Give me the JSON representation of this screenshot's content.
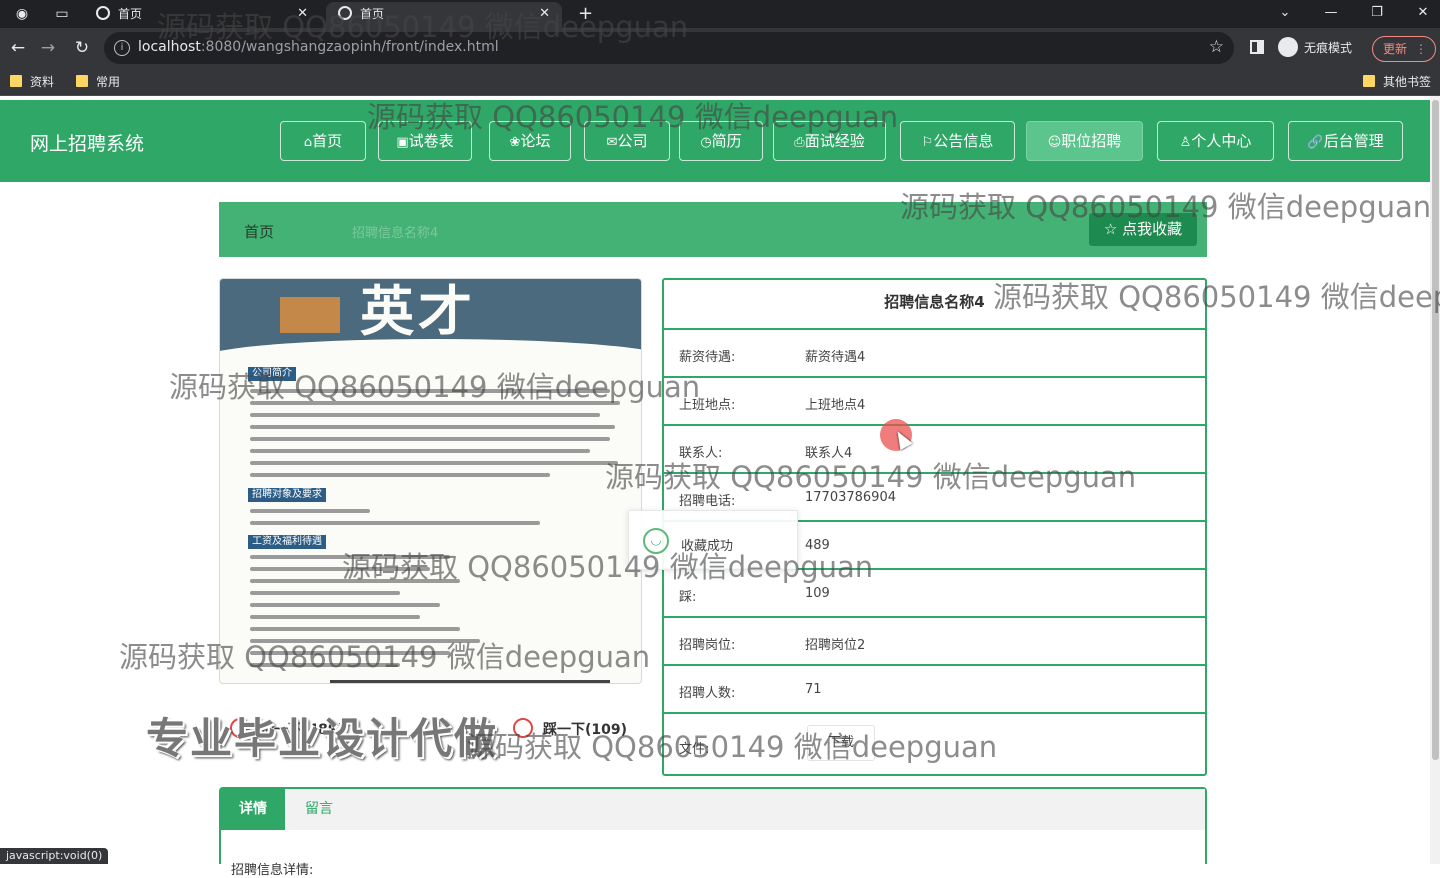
{
  "browser": {
    "tabs": [
      {
        "title": "首页"
      },
      {
        "title": "首页"
      }
    ],
    "url_host": "localhost",
    "url_rest": ":8080/wangshangzaopinh/front/index.html",
    "incognito_label": "无痕模式",
    "update_label": "更新",
    "bookmarks": [
      "资料",
      "常用"
    ],
    "other_bookmarks": "其他书签",
    "status_url": "javascript:void(0)"
  },
  "site": {
    "title": "网上招聘系统",
    "nav": [
      {
        "label": "首页",
        "icon": "home-icon",
        "glyph": "⌂"
      },
      {
        "label": "试卷表",
        "icon": "paper-icon",
        "glyph": "▣"
      },
      {
        "label": "论坛",
        "icon": "chat-icon",
        "glyph": "❀"
      },
      {
        "label": "公司",
        "icon": "mail-icon",
        "glyph": "✉"
      },
      {
        "label": "简历",
        "icon": "power-icon",
        "glyph": "◷"
      },
      {
        "label": "面试经验",
        "icon": "print-icon",
        "glyph": "⎙"
      },
      {
        "label": "公告信息",
        "icon": "flag-icon",
        "glyph": "⚐"
      },
      {
        "label": "职位招聘",
        "icon": "emoji-icon",
        "glyph": "☺"
      },
      {
        "label": "个人中心",
        "icon": "user-icon",
        "glyph": "♙"
      },
      {
        "label": "后台管理",
        "icon": "link-icon",
        "glyph": "🔗"
      }
    ],
    "active_nav": "职位招聘",
    "accent": "#2fa867"
  },
  "breadcrumb": {
    "home": "首页",
    "current": "招聘信息名称4",
    "collect_button": "☆ 点我收藏"
  },
  "poster": {
    "banner": "英才",
    "sections": [
      "公司简介",
      "招聘对象及要求",
      "工资及福利待遇"
    ]
  },
  "detail": {
    "title": "招聘信息名称4",
    "rows": [
      {
        "key": "薪资待遇:",
        "value": "薪资待遇4"
      },
      {
        "key": "上班地点:",
        "value": "上班地点4"
      },
      {
        "key": "联系人:",
        "value": "联系人4"
      },
      {
        "key": "招聘电话:",
        "value": "17703786904"
      },
      {
        "key": "",
        "value": "489"
      },
      {
        "key": "踩:",
        "value": "109"
      },
      {
        "key": "招聘岗位:",
        "value": "招聘岗位2"
      },
      {
        "key": "招聘人数:",
        "value": "71"
      }
    ],
    "file_key": "文件:",
    "file_button": "下载"
  },
  "toast": {
    "message": "收藏成功"
  },
  "votes": {
    "up": "赞一下(489)",
    "down": "踩一下(109)"
  },
  "promo_text": "专业毕业设计代做",
  "tabs": {
    "items": [
      "详情",
      "留言"
    ],
    "content_label": "招聘信息详情:"
  },
  "watermark": "源码获取 QQ86050149 微信deepguan"
}
